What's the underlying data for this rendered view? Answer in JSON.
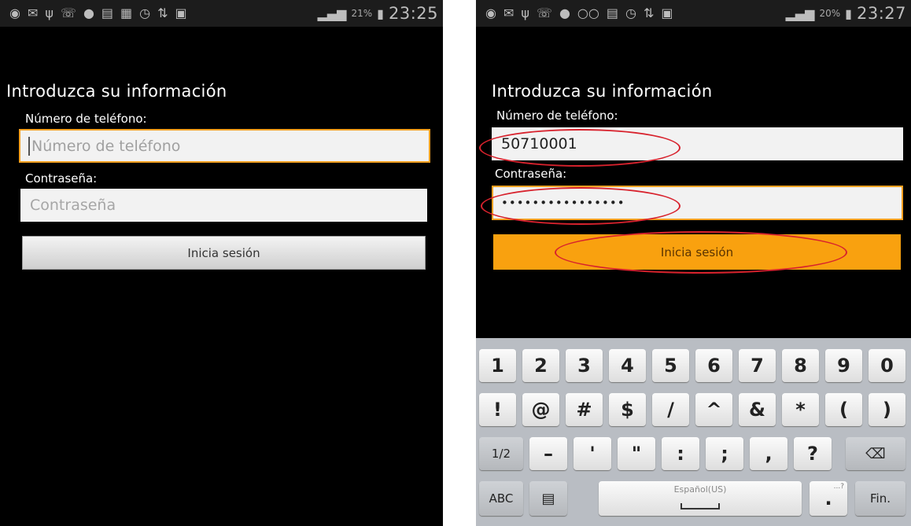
{
  "left": {
    "status": {
      "icons": [
        "notification-icon",
        "mail-icon",
        "usb-icon",
        "whatsapp-icon",
        "messenger-icon",
        "gallery-icon",
        "sim-icon",
        "alarm-icon",
        "data-icon",
        "sim1-icon",
        "signal-icon"
      ],
      "battery": "21%",
      "time": "23:25"
    },
    "form": {
      "title": "Introduzca su información",
      "phone_label": "Número de teléfono:",
      "phone_placeholder": "Número de teléfono",
      "password_label": "Contraseña:",
      "password_placeholder": "Contraseña",
      "login_button": "Inicia sesión"
    }
  },
  "right": {
    "status": {
      "icons": [
        "notification-icon",
        "mail-icon",
        "usb-icon",
        "whatsapp-icon",
        "messenger-icon",
        "voicemail-icon",
        "gallery-icon",
        "alarm-icon",
        "data-icon",
        "sim1-icon",
        "signal-icon"
      ],
      "battery": "20%",
      "time": "23:27"
    },
    "form": {
      "title": "Introduzca su información",
      "phone_label": "Número de teléfono:",
      "phone_value": "50710001",
      "password_label": "Contraseña:",
      "password_value": "••••••••••••••••",
      "login_button": "Inicia sesión"
    },
    "annotation_color": "#d8222d",
    "keyboard": {
      "row1": [
        "1",
        "2",
        "3",
        "4",
        "5",
        "6",
        "7",
        "8",
        "9",
        "0"
      ],
      "row2": [
        "!",
        "@",
        "#",
        "$",
        "/",
        "^",
        "&",
        "*",
        "(",
        ")"
      ],
      "row3": [
        "1/2",
        "–",
        "'",
        "\"",
        ":",
        ";",
        ",",
        "?"
      ],
      "row4": {
        "abc": "ABC",
        "space": "Español(US)",
        "period_hint": "...?",
        "done": "Fin."
      }
    }
  },
  "colors": {
    "accent": "#f9a10f",
    "focus_border": "#f4a020",
    "background": "#000000",
    "field": "#f2f2f2"
  }
}
